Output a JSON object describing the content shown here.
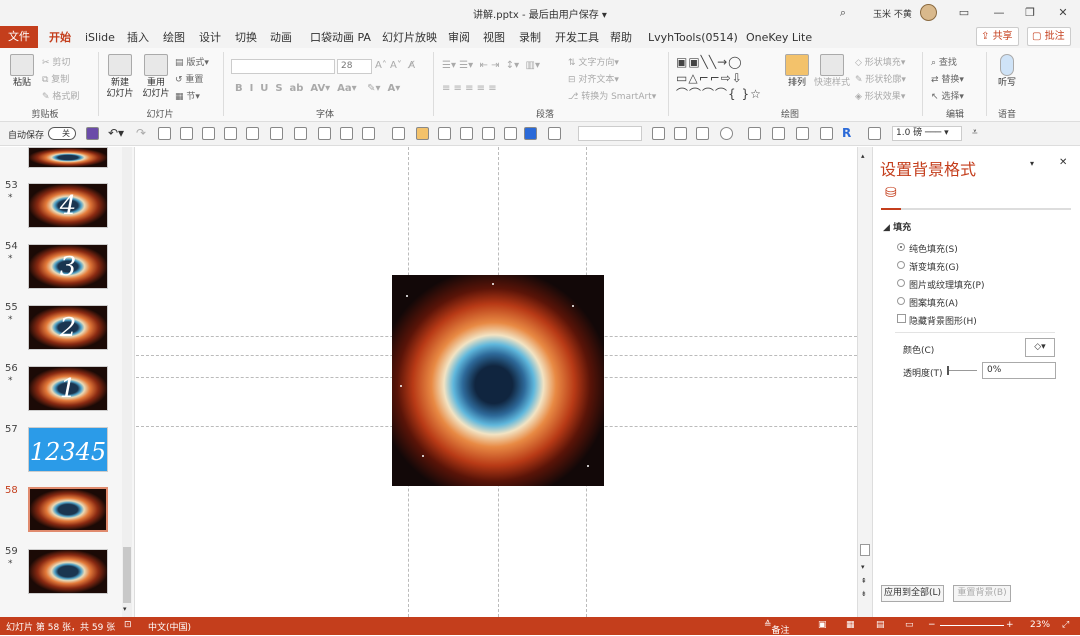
{
  "window": {
    "title": "讲解.pptx  -  最后由用户保存 ▾",
    "user_name": "玉米 不黄"
  },
  "tabs": [
    "文件",
    "开始",
    "iSlide",
    "插入",
    "绘图",
    "设计",
    "切换",
    "动画",
    "口袋动画 PA",
    "幻灯片放映",
    "审阅",
    "视图",
    "录制",
    "开发工具",
    "帮助",
    "LvyhTools(0514)",
    "OneKey Lite"
  ],
  "header_buttons": {
    "share": "共享",
    "comment": "批注"
  },
  "ribbon": {
    "clipboard": {
      "paste": "粘贴",
      "cut": "剪切",
      "copy": "复制",
      "format_painter": "格式刷",
      "label": "剪贴板"
    },
    "slides": {
      "new_slide": "新建\n幻灯片",
      "reuse": "重用\n幻灯片",
      "layout": "版式",
      "reset": "重置",
      "section": "节",
      "label": "幻灯片"
    },
    "font": {
      "size": "28",
      "label": "字体"
    },
    "paragraph": {
      "text_direction": "文字方向",
      "align_text": "对齐文本",
      "convert_smartart": "转换为 SmartArt",
      "label": "段落"
    },
    "drawing": {
      "arrange": "排列",
      "quick_styles": "快速样式",
      "shape_fill": "形状填充",
      "shape_outline": "形状轮廓",
      "shape_effects": "形状效果",
      "label": "绘图"
    },
    "editing": {
      "find": "查找",
      "replace": "替换",
      "select": "选择",
      "label": "编辑"
    },
    "voice": {
      "dictate": "听写",
      "label": "语音"
    }
  },
  "qat": {
    "autosave_label": "自动保存",
    "autosave_state": "关",
    "line_weight": "1.0 磅"
  },
  "slides": [
    {
      "num": "53",
      "star": "*",
      "text": "4",
      "style": "nebula"
    },
    {
      "num": "54",
      "star": "*",
      "text": "3",
      "style": "nebula"
    },
    {
      "num": "55",
      "star": "*",
      "text": "2",
      "style": "nebula"
    },
    {
      "num": "56",
      "star": "*",
      "text": "1",
      "style": "nebula"
    },
    {
      "num": "57",
      "star": "",
      "text": "12345",
      "style": "blue"
    },
    {
      "num": "58",
      "star": "",
      "text": "",
      "style": "nebula",
      "selected": true
    },
    {
      "num": "59",
      "star": "*",
      "text": "",
      "style": "nebula"
    }
  ],
  "format_pane": {
    "title": "设置背景格式",
    "section_fill": "填充",
    "options": [
      "纯色填充(S)",
      "渐变填充(G)",
      "图片或纹理填充(P)",
      "图案填充(A)"
    ],
    "hide_bg_graphics": "隐藏背景图形(H)",
    "color_label": "颜色(C)",
    "transparency_label": "透明度(T)",
    "transparency_value": "0%",
    "apply_all": "应用到全部(L)",
    "reset_bg": "重置背景(B)"
  },
  "status": {
    "slide_info": "幻灯片 第 58 张，共 59 张",
    "language": "中文(中国)",
    "notes": "备注",
    "zoom": "23%"
  },
  "colors": {
    "accent": "#c43e1c"
  }
}
